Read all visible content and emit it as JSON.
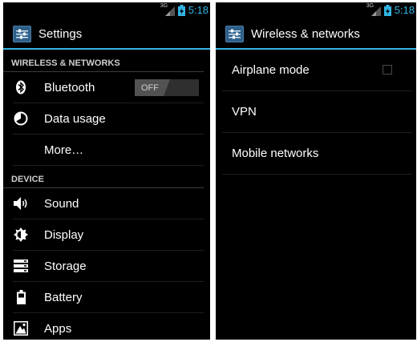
{
  "status_bar": {
    "time": "5:18",
    "network": "3G"
  },
  "left": {
    "title": "Settings",
    "sections": [
      {
        "header": "WIRELESS & NETWORKS",
        "items": [
          {
            "label": "Bluetooth",
            "icon": "bluetooth-icon",
            "toggle": "OFF"
          },
          {
            "label": "Data usage",
            "icon": "data-usage-icon"
          },
          {
            "label": "More…",
            "icon": null
          }
        ]
      },
      {
        "header": "DEVICE",
        "items": [
          {
            "label": "Sound",
            "icon": "sound-icon"
          },
          {
            "label": "Display",
            "icon": "display-icon"
          },
          {
            "label": "Storage",
            "icon": "storage-icon"
          },
          {
            "label": "Battery",
            "icon": "battery-icon"
          },
          {
            "label": "Apps",
            "icon": "apps-icon"
          }
        ]
      }
    ]
  },
  "right": {
    "title": "Wireless & networks",
    "items": [
      {
        "label": "Airplane mode",
        "checked": false
      },
      {
        "label": "VPN"
      },
      {
        "label": "Mobile networks"
      }
    ]
  },
  "colors": {
    "accent": "#33b5e5",
    "background": "#000000",
    "text": "#ffffff"
  }
}
